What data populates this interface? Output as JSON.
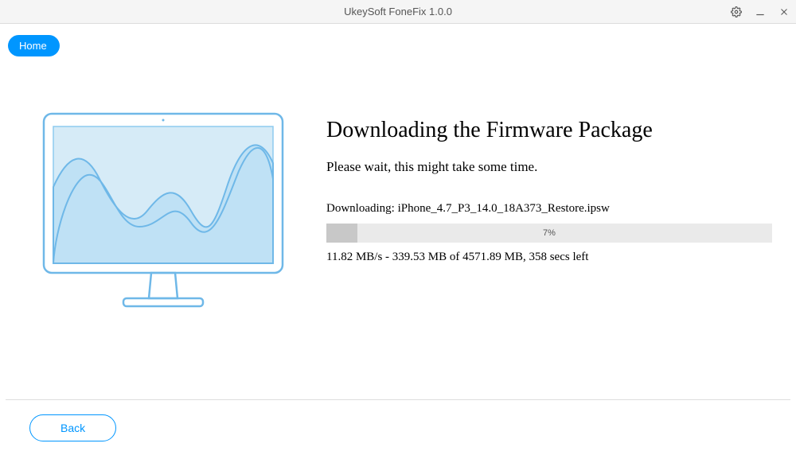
{
  "titlebar": {
    "title": "UkeySoft FoneFix 1.0.0"
  },
  "nav": {
    "home_label": "Home"
  },
  "main": {
    "heading": "Downloading the Firmware Package",
    "subtext": "Please wait, this might take some time.",
    "downloading_prefix": "Downloading: ",
    "filename": "iPhone_4.7_P3_14.0_18A373_Restore.ipsw",
    "progress_percent": "7%",
    "progress_width": "7%",
    "stats": "11.82 MB/s - 339.53 MB of 4571.89 MB, 358 secs left"
  },
  "footer": {
    "back_label": "Back"
  }
}
